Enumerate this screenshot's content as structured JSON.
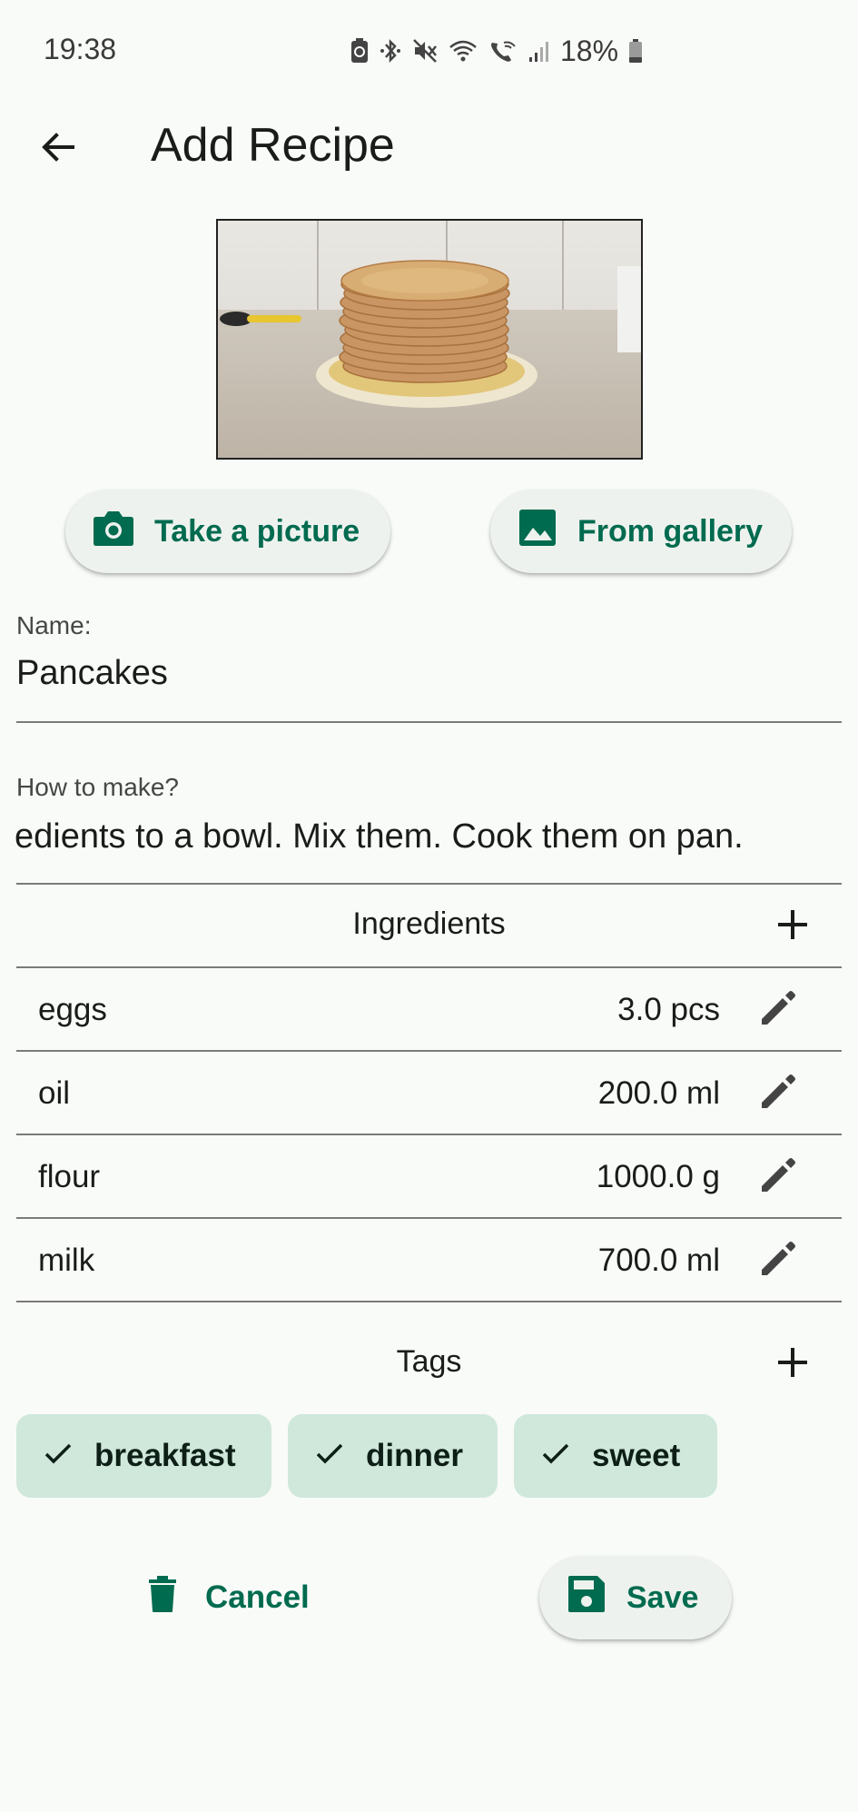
{
  "status_bar": {
    "time": "19:38",
    "battery": "18%",
    "icons": [
      "battery-saver-icon",
      "bluetooth-icon",
      "mute-icon",
      "wifi-icon",
      "wifi-calling-icon",
      "signal-icon",
      "battery-icon"
    ]
  },
  "app_bar": {
    "title": "Add Recipe",
    "back_icon": "arrow-back-icon"
  },
  "photo_buttons": {
    "camera_label": "Take a picture",
    "gallery_label": "From gallery"
  },
  "name_field": {
    "label": "Name:",
    "value": "Pancakes"
  },
  "howto_field": {
    "label": "How to make?",
    "value": "edients to a bowl. Mix them. Cook them on pan."
  },
  "ingredients": {
    "title": "Ingredients",
    "items": [
      {
        "name": "eggs",
        "quantity": "3.0 pcs"
      },
      {
        "name": "oil",
        "quantity": "200.0 ml"
      },
      {
        "name": "flour",
        "quantity": "1000.0 g"
      },
      {
        "name": "milk",
        "quantity": "700.0 ml"
      }
    ]
  },
  "tags": {
    "title": "Tags",
    "items": [
      "breakfast",
      "dinner",
      "sweet"
    ]
  },
  "actions": {
    "cancel_label": "Cancel",
    "save_label": "Save"
  },
  "colors": {
    "background": "#f9fbf8",
    "accent": "#006b4f",
    "chip_background": "#cfe8db",
    "button_background": "#eef2ee"
  }
}
